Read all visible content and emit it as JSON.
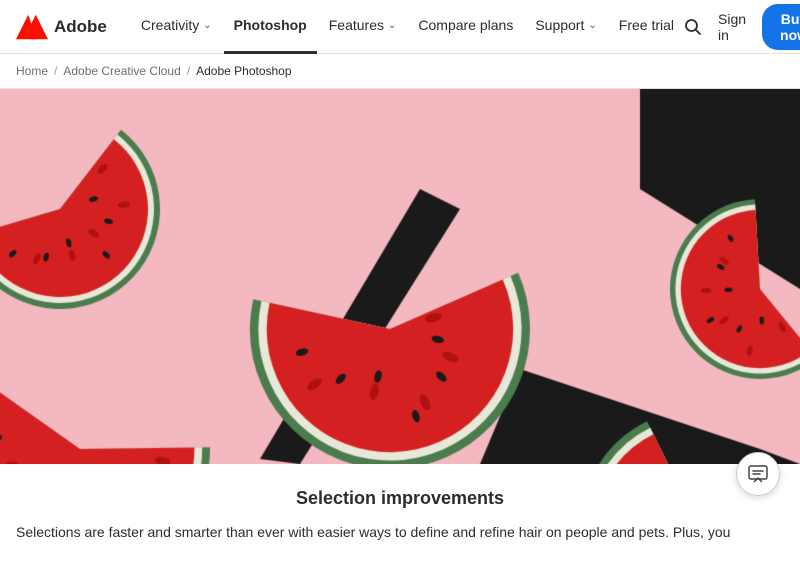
{
  "header": {
    "logo_text": "Adobe",
    "nav_items": [
      {
        "label": "Creativity",
        "has_chevron": true,
        "active": false
      },
      {
        "label": "Photoshop",
        "has_chevron": false,
        "active": true
      },
      {
        "label": "Features",
        "has_chevron": true,
        "active": false
      },
      {
        "label": "Compare plans",
        "has_chevron": false,
        "active": false
      },
      {
        "label": "Support",
        "has_chevron": true,
        "active": false
      },
      {
        "label": "Free trial",
        "has_chevron": false,
        "active": false
      }
    ],
    "buy_now": "Buy now",
    "sign_in": "Sign in"
  },
  "breadcrumb": {
    "items": [
      "Home",
      "Adobe Creative Cloud",
      "Adobe Photoshop"
    ],
    "separators": [
      "/",
      "/"
    ]
  },
  "content": {
    "title": "Selection improvements",
    "body": "Selections are faster and smarter than ever with easier ways to define and refine hair on people and pets. Plus, you"
  },
  "hero": {
    "description": "Watermelon slices on pink background with shadows"
  },
  "chat": {
    "label": "Chat"
  },
  "colors": {
    "accent_blue": "#1473e6",
    "adobe_red": "#fa0f00",
    "nav_active_border": "#2c2c2c"
  }
}
